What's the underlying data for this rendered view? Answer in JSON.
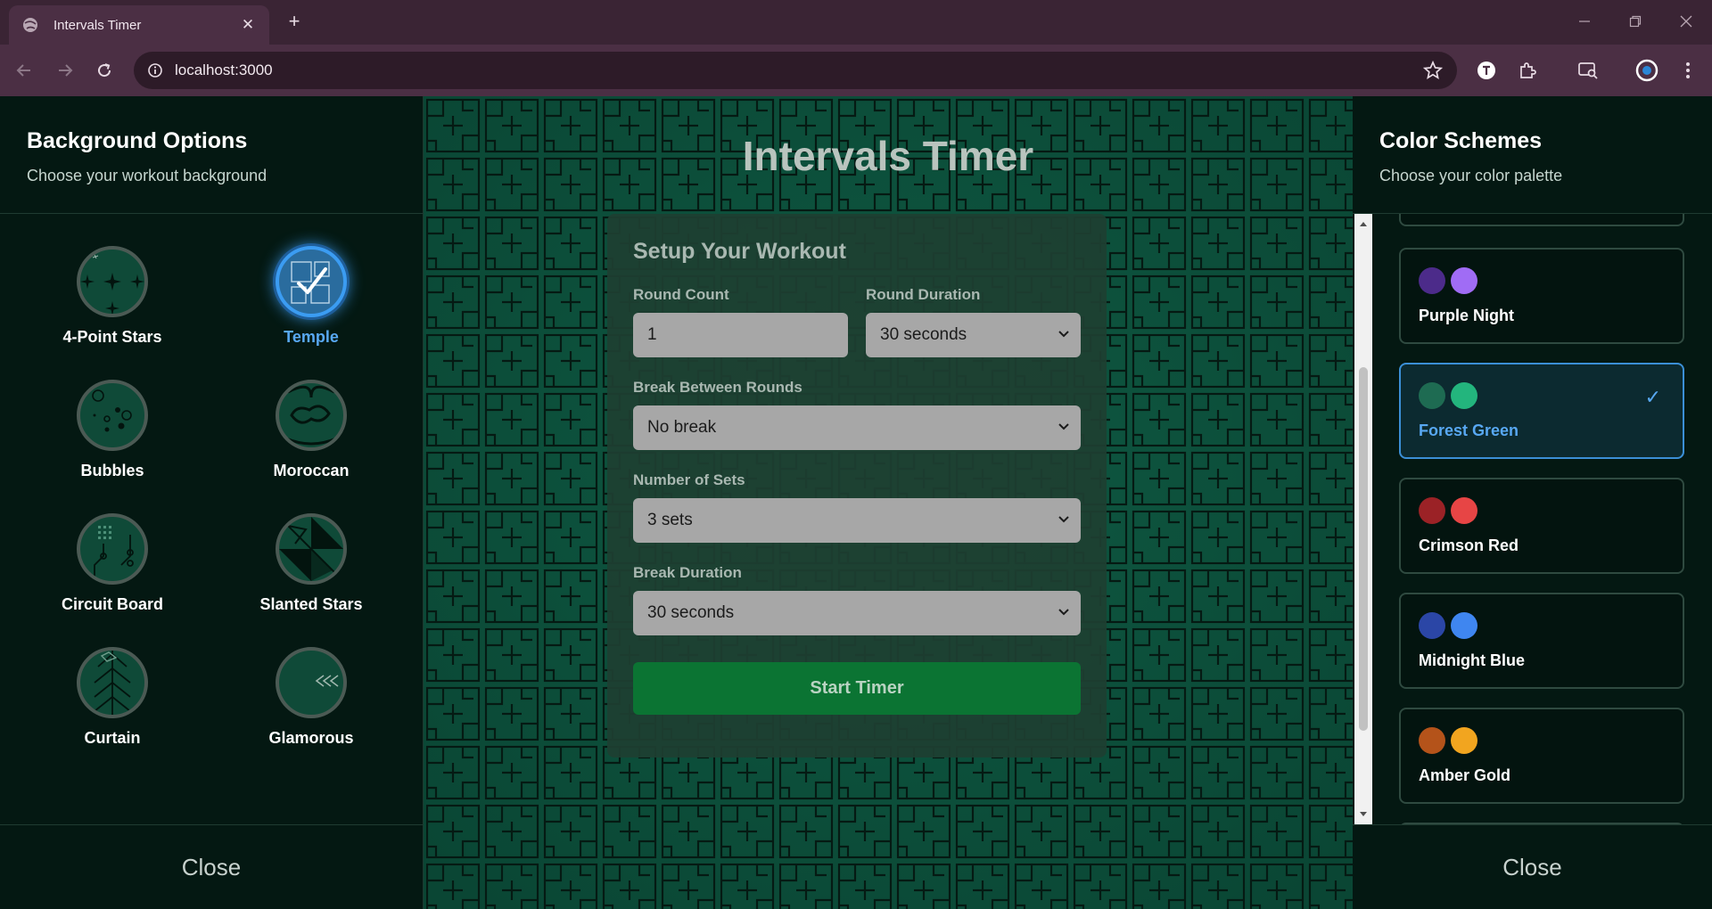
{
  "browser": {
    "tab_title": "Intervals Timer",
    "url": "localhost:3000"
  },
  "left_panel": {
    "title": "Background Options",
    "subtitle": "Choose your workout background",
    "options": [
      {
        "label": "4-Point Stars",
        "selected": false
      },
      {
        "label": "Temple",
        "selected": true
      },
      {
        "label": "Bubbles",
        "selected": false
      },
      {
        "label": "Moroccan",
        "selected": false
      },
      {
        "label": "Circuit Board",
        "selected": false
      },
      {
        "label": "Slanted Stars",
        "selected": false
      },
      {
        "label": "Curtain",
        "selected": false
      },
      {
        "label": "Glamorous",
        "selected": false
      }
    ],
    "close_label": "Close"
  },
  "main": {
    "app_title": "Intervals Timer",
    "setup_title": "Setup Your Workout",
    "round_count_label": "Round Count",
    "round_count_value": "1",
    "round_duration_label": "Round Duration",
    "round_duration_value": "30 seconds",
    "break_between_label": "Break Between Rounds",
    "break_between_value": "No break",
    "sets_label": "Number of Sets",
    "sets_value": "3 sets",
    "break_duration_label": "Break Duration",
    "break_duration_value": "30 seconds",
    "start_label": "Start Timer"
  },
  "right_panel": {
    "title": "Color Schemes",
    "subtitle": "Choose your color palette",
    "schemes": [
      {
        "name": "Purple Night",
        "colors": [
          "#4c2b8a",
          "#a06cf5"
        ],
        "selected": false
      },
      {
        "name": "Forest Green",
        "colors": [
          "#1e6b52",
          "#23b57d"
        ],
        "selected": true
      },
      {
        "name": "Crimson Red",
        "colors": [
          "#9b2226",
          "#e74545"
        ],
        "selected": false
      },
      {
        "name": "Midnight Blue",
        "colors": [
          "#2b46a6",
          "#3f86f0"
        ],
        "selected": false
      },
      {
        "name": "Amber Gold",
        "colors": [
          "#b4531a",
          "#f2a51f"
        ],
        "selected": false
      }
    ],
    "close_label": "Close"
  },
  "colors": {
    "accent": "#3b9cf2",
    "start_button": "#0b7433",
    "panel_bg": "#041812"
  }
}
